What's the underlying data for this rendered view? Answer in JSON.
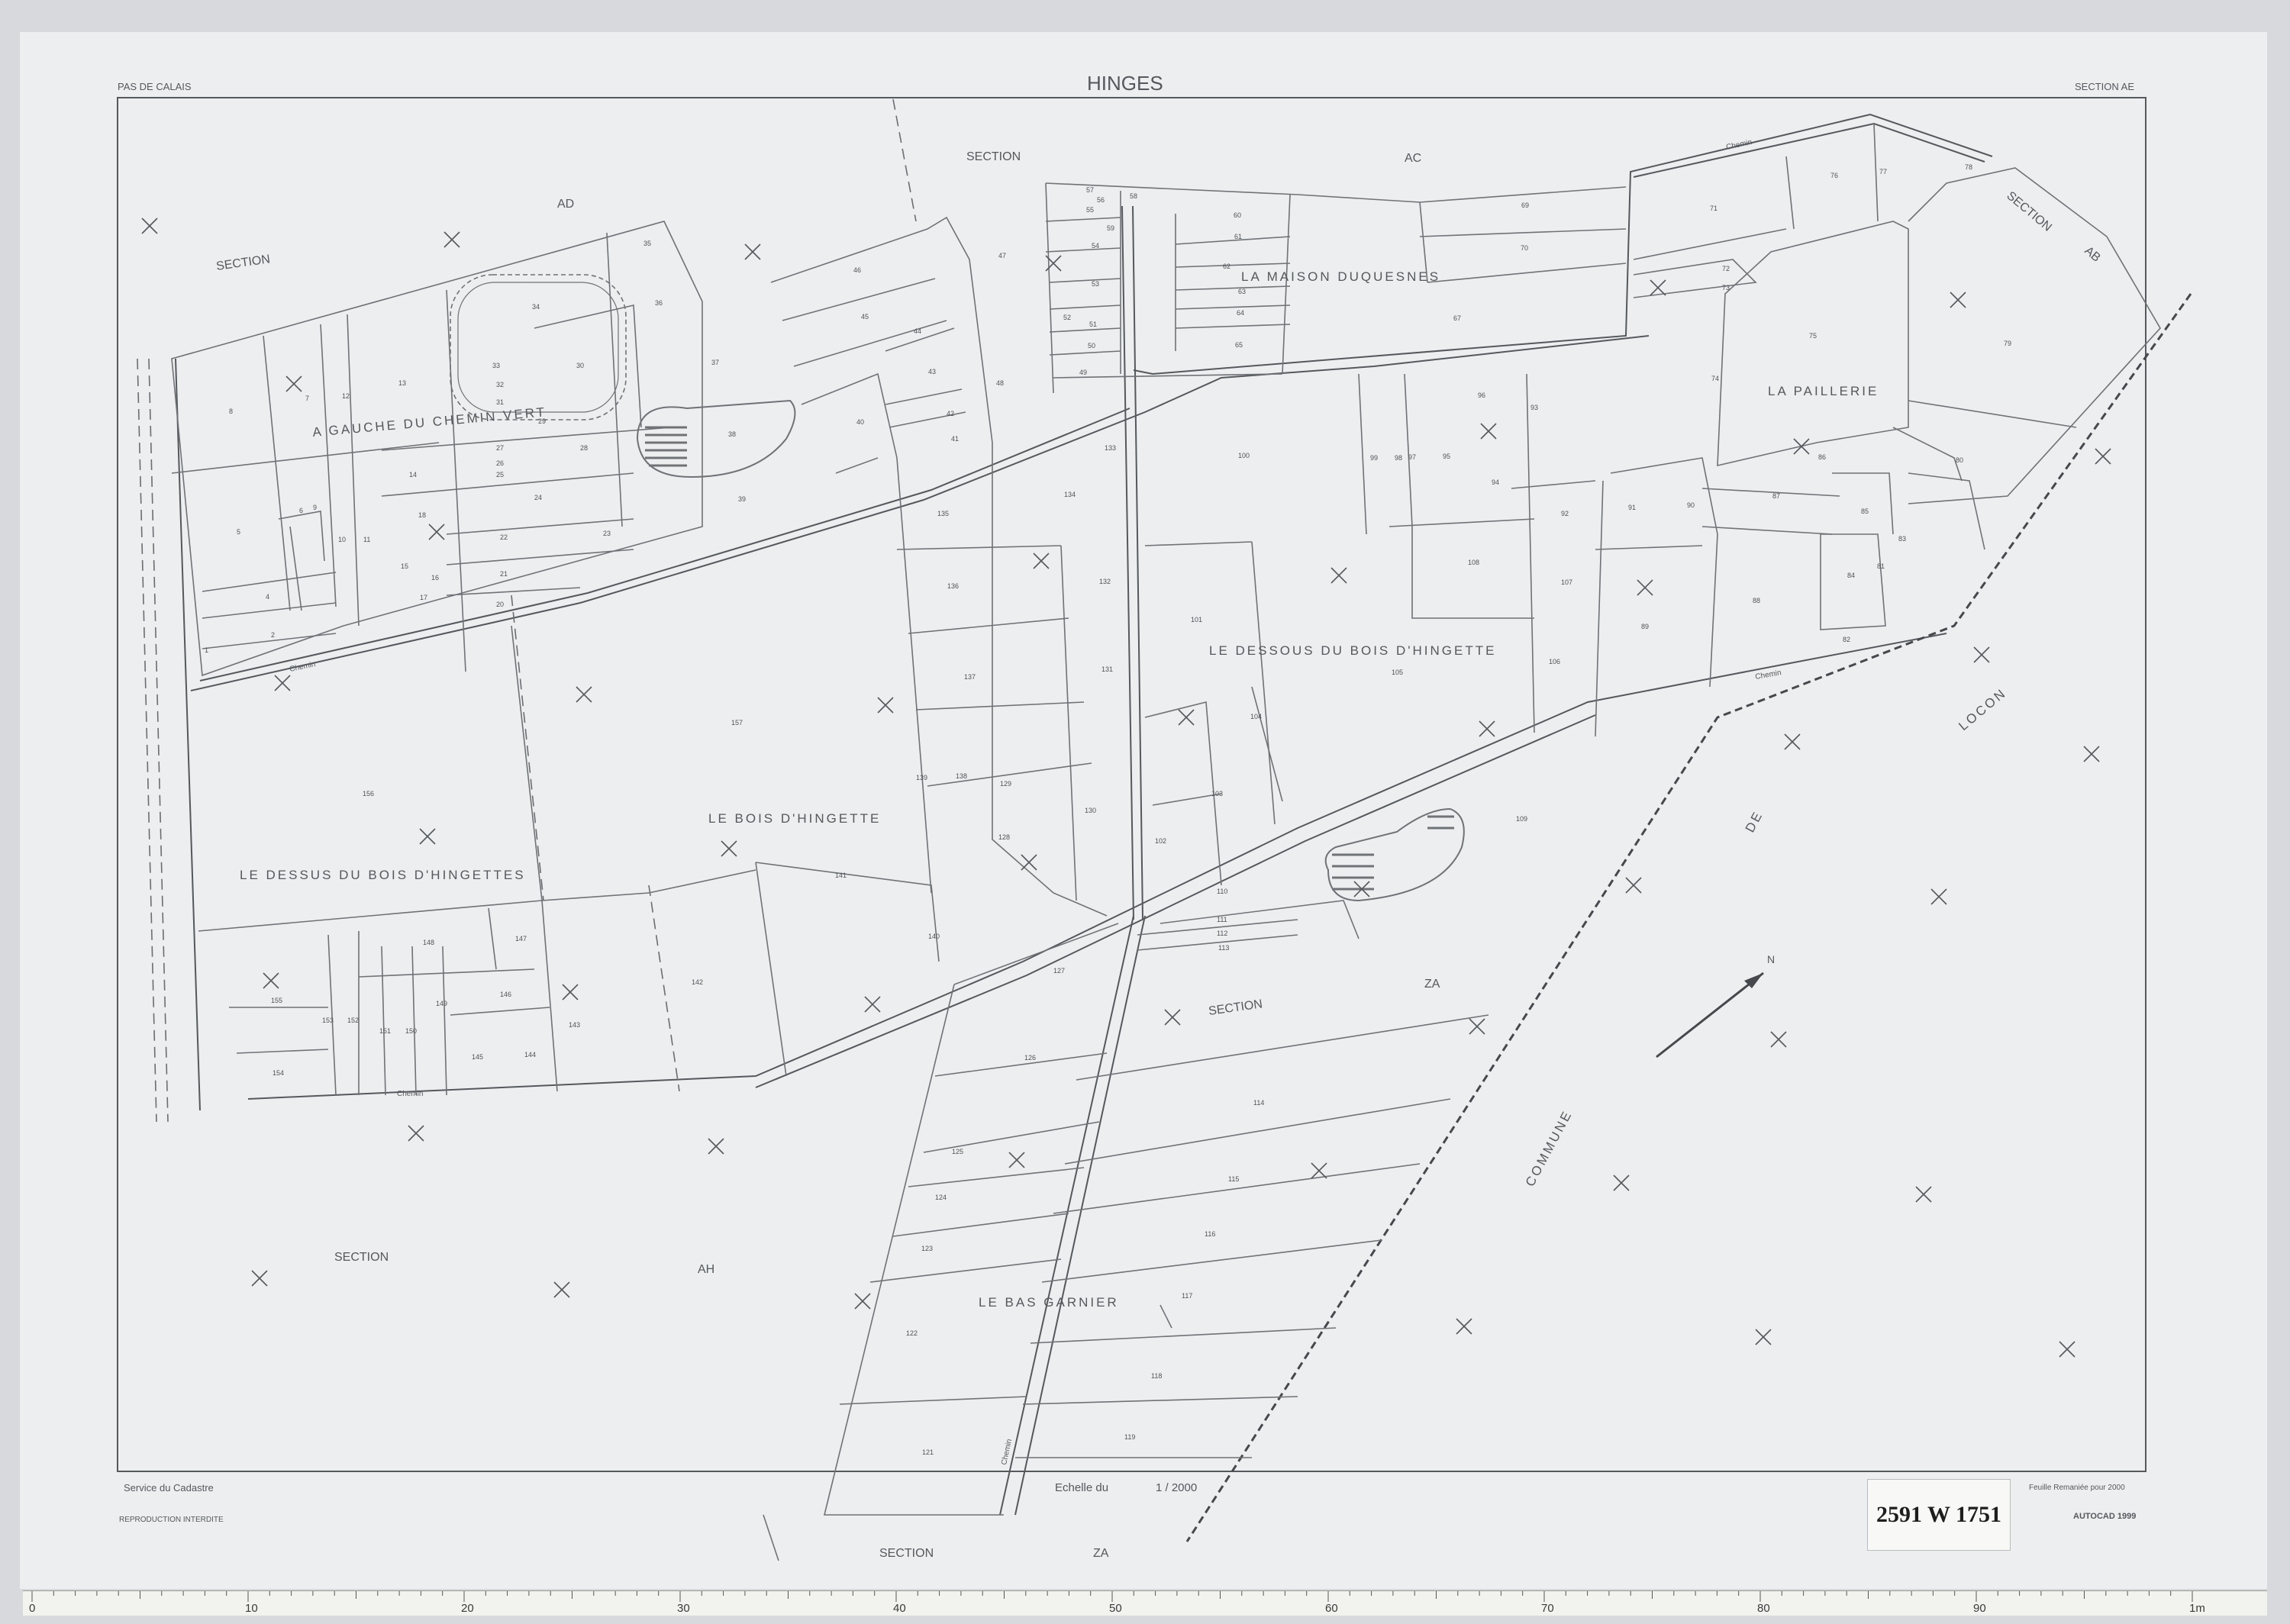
{
  "sheet": {
    "department": "PAS DE CALAIS",
    "commune": "HINGES",
    "section": "SECTION AE",
    "producer": "Service du Cadastre",
    "reproduction": "REPRODUCTION INTERDITE",
    "scale_label": "Echelle du",
    "scale_value": "1 / 2000",
    "revision": "Feuille Remaniée pour 2000",
    "software": "AUTOCAD 1999"
  },
  "archive_stamp": "2591 W 1751",
  "lieux_dits": [
    "A GAUCHE DU CHEMIN VERT",
    "LA MAISON DUQUESNES",
    "LA PAILLERIE",
    "LE DESSOUS DU BOIS D'HINGETTE",
    "LE BOIS D'HINGETTE",
    "LE DESSUS DU BOIS D'HINGETTES",
    "LE BAS GARNIER"
  ],
  "neighbour_sections": [
    "SECTION",
    "AD",
    "SECTION",
    "AC",
    "SECTION",
    "AB",
    "SECTION",
    "ZA",
    "SECTION",
    "AH",
    "SECTION",
    "ZA",
    "COMMUNE",
    "DE",
    "LOCON"
  ],
  "road_labels": [
    "Chemin",
    "Chemin",
    "Chemin",
    "Chemin",
    "Chemin"
  ],
  "parcels": [
    "1",
    "2",
    "4",
    "5",
    "6",
    "7",
    "8",
    "9",
    "10",
    "11",
    "12",
    "13",
    "14",
    "15",
    "16",
    "17",
    "18",
    "20",
    "21",
    "22",
    "23",
    "24",
    "25",
    "26",
    "27",
    "28",
    "29",
    "30",
    "31",
    "32",
    "33",
    "34",
    "35",
    "36",
    "37",
    "38",
    "39",
    "40",
    "41",
    "42",
    "43",
    "44",
    "45",
    "46",
    "47",
    "48",
    "49",
    "50",
    "51",
    "52",
    "53",
    "54",
    "55",
    "56",
    "57",
    "58",
    "59",
    "60",
    "61",
    "62",
    "63",
    "64",
    "65",
    "67",
    "69",
    "70",
    "71",
    "72",
    "73",
    "74",
    "75",
    "76",
    "77",
    "78",
    "79",
    "80",
    "81",
    "82",
    "83",
    "84",
    "85",
    "86",
    "87",
    "88",
    "89",
    "90",
    "91",
    "92",
    "93",
    "94",
    "95",
    "96",
    "97",
    "98",
    "99",
    "100",
    "101",
    "102",
    "103",
    "104",
    "105",
    "106",
    "107",
    "108",
    "109",
    "110",
    "111",
    "112",
    "113",
    "114",
    "115",
    "116",
    "117",
    "118",
    "119",
    "121",
    "122",
    "123",
    "124",
    "125",
    "126",
    "127",
    "128",
    "129",
    "130",
    "131",
    "132",
    "133",
    "134",
    "135",
    "136",
    "137",
    "138",
    "139",
    "140",
    "141",
    "142",
    "143",
    "144",
    "145",
    "146",
    "147",
    "148",
    "149",
    "150",
    "151",
    "152",
    "153",
    "154",
    "155",
    "156",
    "157"
  ],
  "ruler_numbers": [
    "0",
    "10",
    "20",
    "30",
    "40",
    "50",
    "60",
    "70",
    "80",
    "90",
    "1m"
  ],
  "north_label": "N"
}
